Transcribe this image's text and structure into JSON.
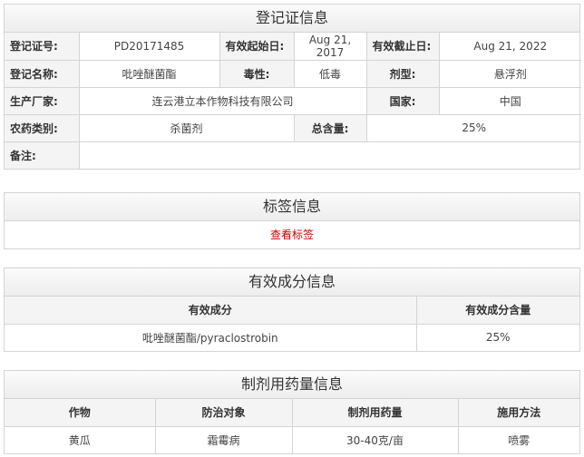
{
  "registration": {
    "title": "登记证信息",
    "reg_no_label": "登记证号:",
    "reg_no": "PD20171485",
    "start_label": "有效起始日:",
    "start": "Aug 21, 2017",
    "end_label": "有效截止日:",
    "end": "Aug 21, 2022",
    "name_label": "登记名称:",
    "name": "吡唑醚菌酯",
    "toxicity_label": "毒性:",
    "toxicity": "低毒",
    "formulation_label": "剂型:",
    "formulation": "悬浮剂",
    "maker_label": "生产厂家:",
    "maker": "连云港立本作物科技有限公司",
    "country_label": "国家:",
    "country": "中国",
    "category_label": "农药类别:",
    "category": "杀菌剂",
    "total_label": "总含量:",
    "total": "25%",
    "remark_label": "备注:",
    "remark": ""
  },
  "label_info": {
    "title": "标签信息",
    "link": "查看标签"
  },
  "ingredients": {
    "title": "有效成分信息",
    "headers": [
      "有效成分",
      "有效成分含量"
    ],
    "rows": [
      [
        "吡唑醚菌酯/pyraclostrobin",
        "25%"
      ]
    ]
  },
  "dosage": {
    "title": "制剂用药量信息",
    "headers": [
      "作物",
      "防治对象",
      "制剂用药量",
      "施用方法"
    ],
    "rows": [
      [
        "黄瓜",
        "霜霉病",
        "30-40克/亩",
        "喷雾"
      ]
    ]
  }
}
